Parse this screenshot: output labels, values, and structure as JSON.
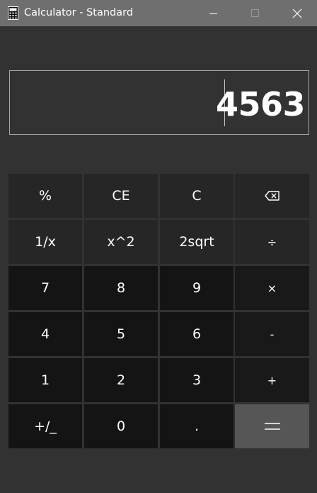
{
  "window": {
    "title": "Calculator - Standard",
    "icon": "calculator-icon",
    "controls": [
      "minimize-icon",
      "maximize-icon",
      "close-icon"
    ]
  },
  "display": {
    "value": "4563"
  },
  "keypad": {
    "rows": [
      [
        {
          "label": "%",
          "name": "percent-button"
        },
        {
          "label": "CE",
          "name": "clear-entry-button"
        },
        {
          "label": "C",
          "name": "clear-button"
        },
        {
          "label": "",
          "name": "backspace-button",
          "icon": "backspace-icon"
        }
      ],
      [
        {
          "label": "1/x",
          "name": "reciprocal-button"
        },
        {
          "label": "x^2",
          "name": "square-button"
        },
        {
          "label": "2sqrt",
          "name": "square-root-button"
        },
        {
          "label": "÷",
          "name": "divide-button"
        }
      ],
      [
        {
          "label": "7",
          "name": "digit-7-button"
        },
        {
          "label": "8",
          "name": "digit-8-button"
        },
        {
          "label": "9",
          "name": "digit-9-button"
        },
        {
          "label": "×",
          "name": "multiply-button"
        }
      ],
      [
        {
          "label": "4",
          "name": "digit-4-button"
        },
        {
          "label": "5",
          "name": "digit-5-button"
        },
        {
          "label": "6",
          "name": "digit-6-button"
        },
        {
          "label": "-",
          "name": "subtract-button"
        }
      ],
      [
        {
          "label": "1",
          "name": "digit-1-button"
        },
        {
          "label": "2",
          "name": "digit-2-button"
        },
        {
          "label": "3",
          "name": "digit-3-button"
        },
        {
          "label": "+",
          "name": "add-button"
        }
      ],
      [
        {
          "label": "+/_",
          "name": "negate-button"
        },
        {
          "label": "0",
          "name": "digit-0-button"
        },
        {
          "label": ".",
          "name": "decimal-button"
        },
        {
          "label": "",
          "name": "equals-button",
          "icon": "equals-icon"
        }
      ]
    ]
  },
  "colors": {
    "background": "#323232",
    "titlebar": "#6f6f6f",
    "function_key": "#262626",
    "digit_key": "#141414",
    "equals_key": "#565656",
    "display_border": "#a8a8a8"
  }
}
